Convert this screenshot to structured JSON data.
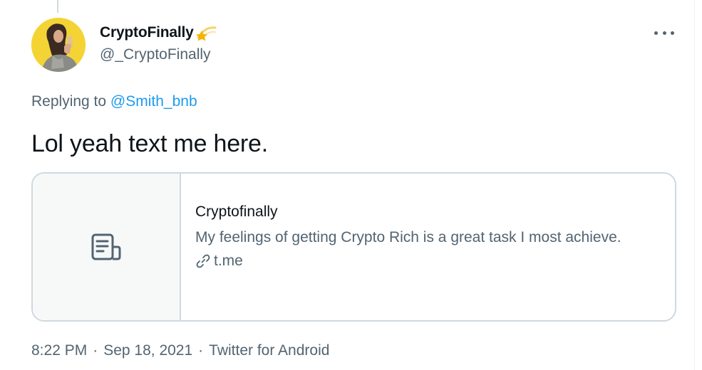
{
  "author": {
    "display_name": "CryptoFinally",
    "handle": "@_CryptoFinally",
    "name_emoji": "shooting-star-emoji",
    "avatar": "profile-photo"
  },
  "reply": {
    "prefix": "Replying to",
    "mention": "@Smith_bnb"
  },
  "tweet": {
    "text": "Lol yeah text me here."
  },
  "card": {
    "thumb_icon": "document-icon",
    "title": "Cryptofinally",
    "description": "My feelings of getting Crypto Rich is a great task I most achieve.",
    "link_icon": "link-icon",
    "domain": "t.me"
  },
  "meta": {
    "time": "8:22 PM",
    "separator": "·",
    "date": "Sep 18, 2021",
    "source": "Twitter for Android"
  },
  "menu": {
    "icon": "more-icon"
  },
  "colors": {
    "text_primary": "#0f1419",
    "text_secondary": "#536471",
    "accent": "#1d9bf0",
    "border": "#cfd9de",
    "avatar_bg": "#f4d435"
  }
}
